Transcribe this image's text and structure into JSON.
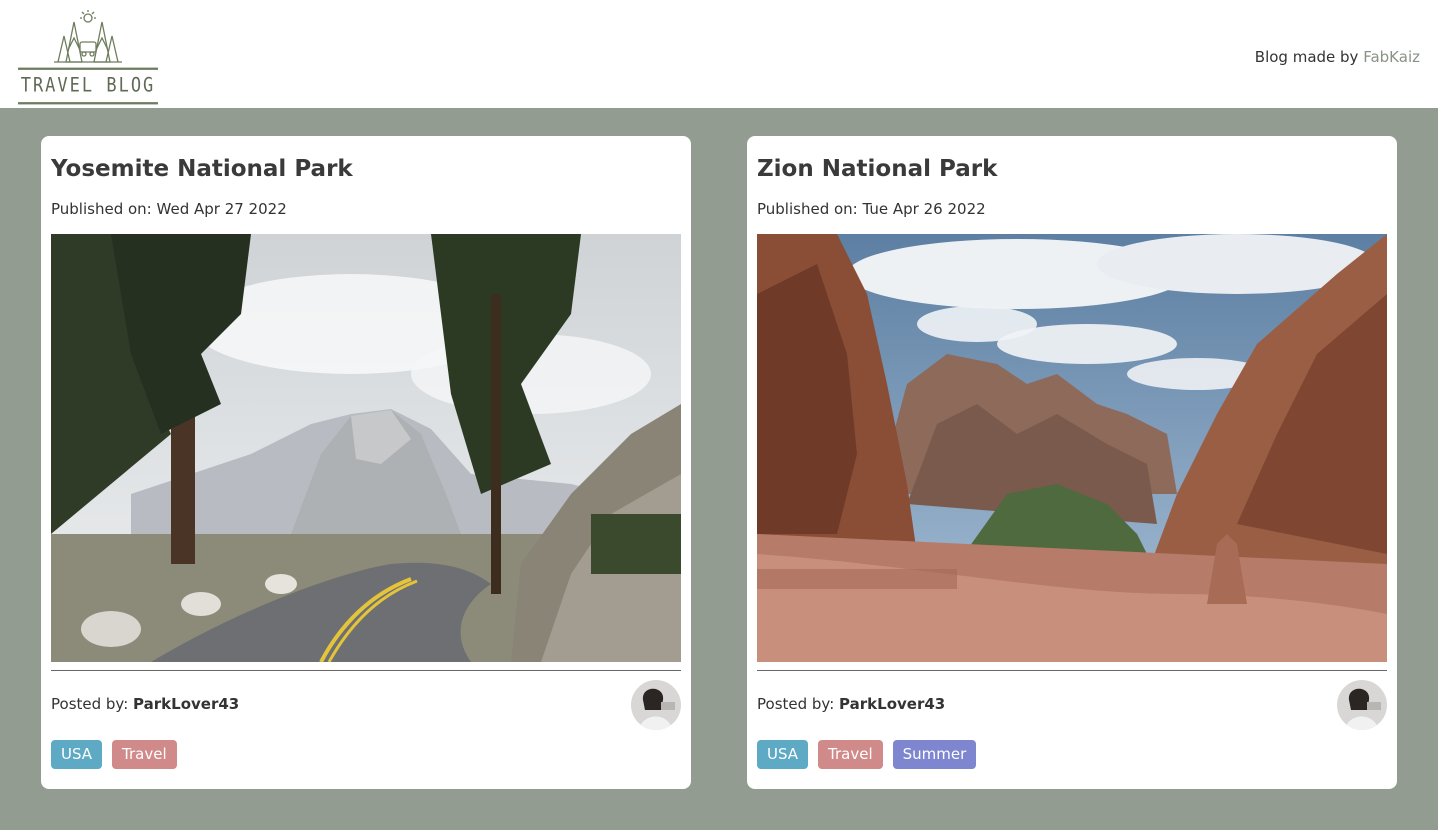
{
  "header": {
    "logo_text": "TRAVEL BLOG",
    "credit_prefix": "Blog made by",
    "credit_author": "FabKaiz"
  },
  "posts": [
    {
      "title": "Yosemite National Park",
      "date_label": "Published on:",
      "date": "Wed Apr 27 2022",
      "posted_label": "Posted by:",
      "author": "ParkLover43",
      "tags": [
        {
          "label": "USA",
          "color": "#5ea9c4"
        },
        {
          "label": "Travel",
          "color": "#d08a8a"
        }
      ]
    },
    {
      "title": "Zion National Park",
      "date_label": "Published on:",
      "date": "Tue Apr 26 2022",
      "posted_label": "Posted by:",
      "author": "ParkLover43",
      "tags": [
        {
          "label": "USA",
          "color": "#5ea9c4"
        },
        {
          "label": "Travel",
          "color": "#d08a8a"
        },
        {
          "label": "Summer",
          "color": "#7e86cf"
        }
      ]
    }
  ]
}
